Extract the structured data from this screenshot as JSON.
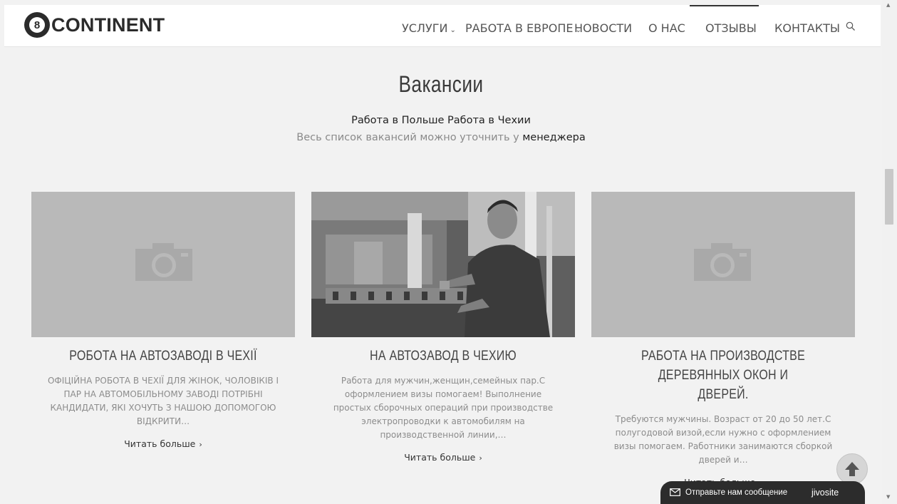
{
  "header": {
    "logo_number": "8",
    "logo_text": "CONTINENT",
    "nav": [
      {
        "label": "УСЛУГИ",
        "has_dropdown": true
      },
      {
        "label": "РАБОТА В ЕВРОПЕ",
        "has_dropdown": true
      },
      {
        "label": "НОВОСТИ",
        "has_dropdown": false
      },
      {
        "label": "О НАС",
        "has_dropdown": false
      },
      {
        "label": "ОТЗЫВЫ",
        "has_dropdown": false,
        "active": true
      },
      {
        "label": "КОНТАКТЫ",
        "has_dropdown": false
      }
    ],
    "search_icon": "search-icon"
  },
  "section": {
    "title": "Вакансии",
    "link_poland": "Работа в Польше",
    "link_czech": "Работа в Чехии",
    "note_text": "Весь список вакансий можно уточнить у",
    "note_link": "менеджера"
  },
  "cards": [
    {
      "image": "camera-placeholder",
      "title": "РОБОТА НА АВТОЗАВОДІ В ЧЕХІЇ",
      "description": "ОФІЦІЙНА РОБОТА В ЧЕХІЇ ДЛЯ ЖІНОК, ЧОЛОВІКІВ І ПАР НА АВТОМОБІЛЬНОМУ ЗАВОДІ ПОТРІБНІ КАНДИДАТИ, ЯКІ ХОЧУТЬ З НАШОЮ ДОПОМОГОЮ ВІДКРИТИ…",
      "more": "Читать больше"
    },
    {
      "image": "factory-worker-photo",
      "title": "НА АВТОЗАВОД В ЧЕХИЮ",
      "description": "Работа для мужчин,женщин,семейных пар.С оформлением визы помогаем! Выполнение простых сборочных операций при производстве электропроводки к автомобилям на производственной линии,…",
      "more": "Читать больше"
    },
    {
      "image": "camera-placeholder",
      "title": "РАБОТА НА ПРОИЗВОДСТВЕ ДЕРЕВЯННЫХ ОКОН И ДВЕРЕЙ.",
      "description": "Требуются мужчины. Возраст от 20 до 50 лет.С полугодовой визой,если нужно с оформлением визы помогаем. Работники занимаются сборкой дверей и…",
      "more": "Читать больше"
    }
  ],
  "widgets": {
    "chat_label": "Отправьте нам сообщение",
    "chat_brand": "jivosite",
    "to_top_icon": "arrow-up-icon"
  },
  "colors": {
    "page_bg": "#f2f2f2",
    "header_bg": "#ffffff",
    "placeholder_bg": "#b9b9b9",
    "chat_bg": "#2c2c2c"
  }
}
